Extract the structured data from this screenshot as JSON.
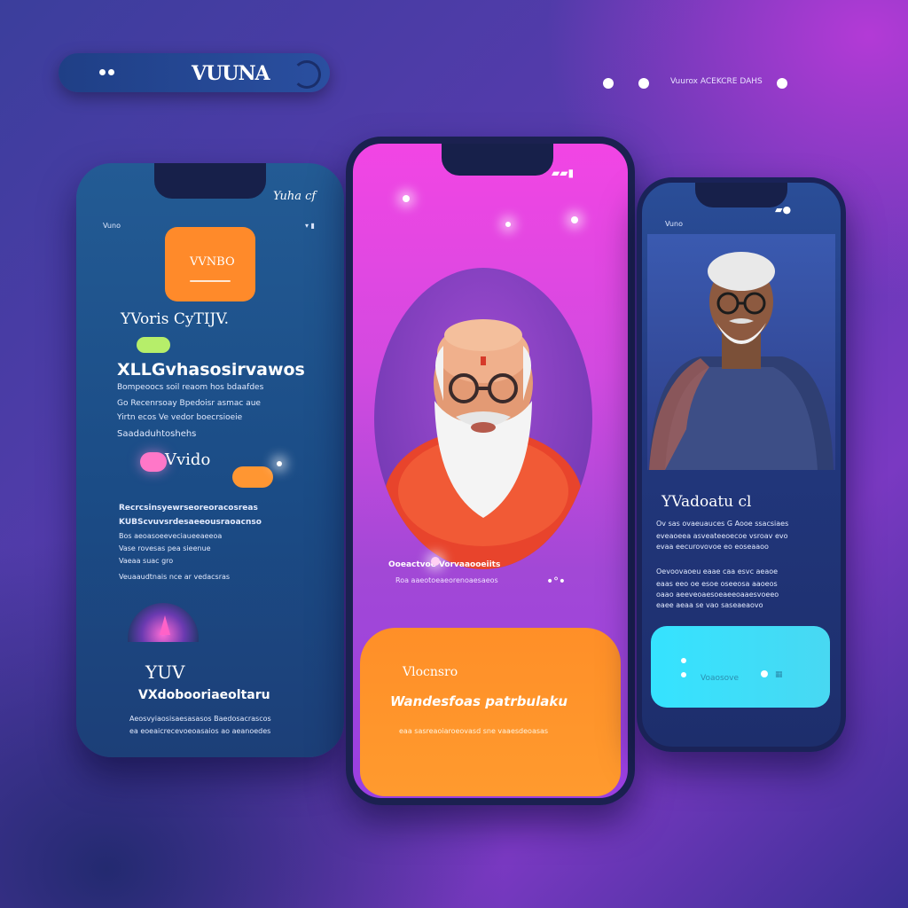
{
  "topbar": {
    "brand": "VUUNA"
  },
  "floatnav": {
    "text": "Vuurox   ACEKCRE DAHS"
  },
  "left_phone": {
    "status_right": "Yuha cf",
    "status_left": "Vuno",
    "orange_card_label": "VVNBO",
    "subtitle": "YVoris CyTIJV.",
    "heading": "XLLGvhasosirvawos",
    "body_lines": [
      "Bompeoocs soil reaom hos bdaafdes",
      "Go Recenrsoay Bpedoisr asmac aue",
      "Yirtn ecos Ve vedor boecrsioeie",
      "Saadaduhtoshehs"
    ],
    "pill_label": "Vvido",
    "para_lines": [
      "Recrcsinsyewrseoreoracosreas",
      "KUBScvuvsrdesaeeousraoacnso",
      "Bos aeoasoeeveciaueeaeeoa",
      "Vase rovesas pea sieenue",
      "Vaeaa suac gro"
    ],
    "footer_link": "Veuaaudtnais      nce ar vedacsras",
    "section_title": "YUV",
    "section_heading": "VXdobooriaeoltaru",
    "section_lines": [
      "Aeosvyiaosisaesasasos  Baedosacrascos",
      "ea eoeaicrecevoeoasaios ao aeanoedes"
    ]
  },
  "center_phone": {
    "caption_1": "Ooeactvoe Vorvaaooeiits",
    "caption_2": "Roa aaeotoeaeorenoaesaeos",
    "panel_title": "Vlocnsro",
    "panel_heading": "Wandesfoas patrbulaku",
    "panel_line": "eaa sasreaoiaroeovasd sne vaaesdeoasas"
  },
  "right_phone": {
    "status_left": "Vuno",
    "name_title": "YVadoatu cl",
    "lines_1": [
      "Ov sas ovaeuauces G Aooe ssacsiaes",
      "eveaoeea asveateeoecoe vsroav evo",
      "evaa eecurovovoe eo  eoseaaoo"
    ],
    "lines_2": [
      "Oevoovaoeu eaae caa esvc aeaoe",
      "eaas eeo oe esoe oseeosa aaoeos",
      "oaao aeeveoaesoeaeeoaaesvoeeo",
      "eaee aeaa se vao saseaeaovo"
    ],
    "cyan_card_label": "Voaosove"
  },
  "colors": {
    "accent_orange": "#ff8a2a",
    "accent_magenta": "#f245e4",
    "accent_cyan": "#35e3ff",
    "navy": "#1b4c86"
  }
}
